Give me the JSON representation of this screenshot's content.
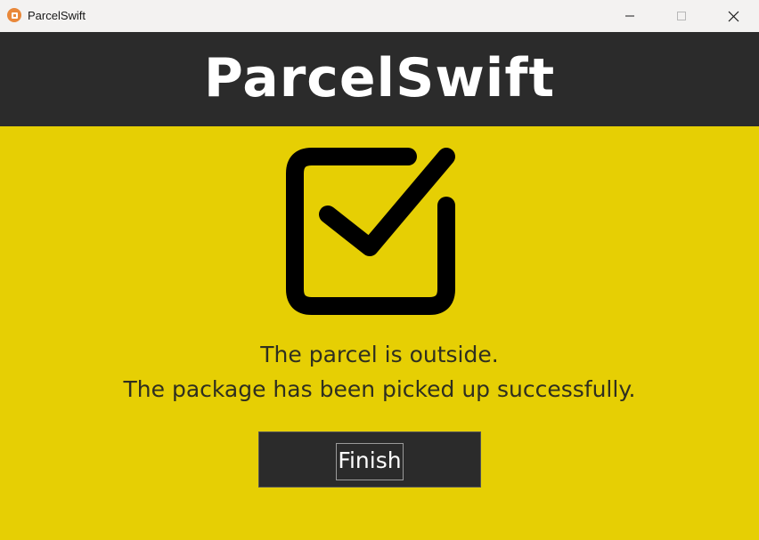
{
  "window": {
    "title": "ParcelSwift",
    "controls": {
      "minimize": "minimize-icon",
      "maximize": "maximize-icon",
      "close": "close-icon"
    }
  },
  "header": {
    "brand": "ParcelSwift"
  },
  "main": {
    "icon": "checkbox-checked-icon",
    "message_line1": "The parcel is outside.",
    "message_line2": "The package has been picked up successfully.",
    "finish_label": "Finish"
  },
  "colors": {
    "background": "#e6cf04",
    "header": "#2b2b2b",
    "button": "#2b2b2b",
    "text": "#2f2f20",
    "app_icon": "#e9883a"
  }
}
